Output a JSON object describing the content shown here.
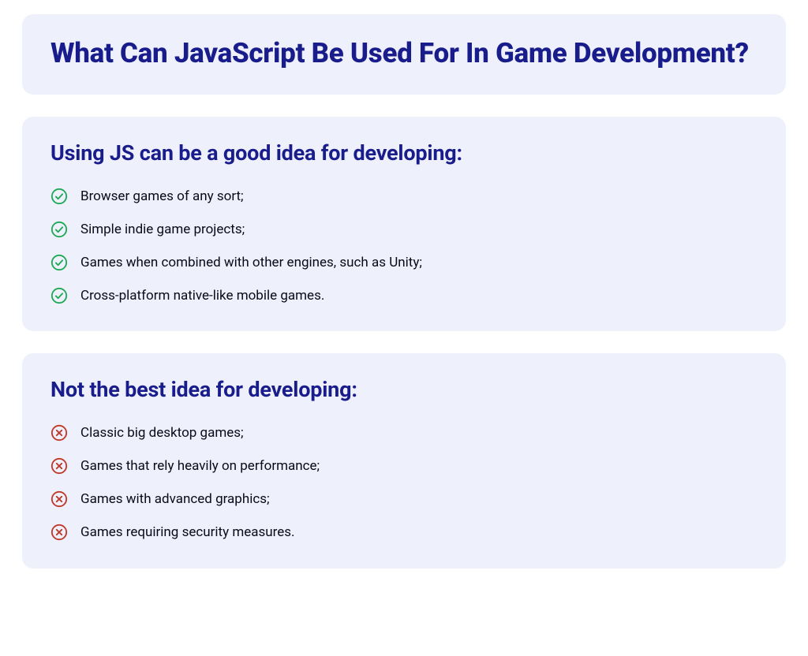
{
  "header": {
    "title": "What Can JavaScript Be Used For In Game Development?"
  },
  "sections": [
    {
      "heading": "Using JS can be a good idea for developing:",
      "icon": "check",
      "items": [
        "Browser games of any sort;",
        "Simple indie game projects;",
        "Games when combined with other engines, such as Unity;",
        "Cross-platform native-like mobile games."
      ]
    },
    {
      "heading": "Not the best idea for developing:",
      "icon": "cross",
      "items": [
        "Classic big desktop games;",
        "Games that rely heavily on performance;",
        "Games with advanced graphics;",
        "Games requiring security measures."
      ]
    }
  ],
  "colors": {
    "brand": "#191d8c",
    "card_bg": "#eef0fb",
    "check": "#1ea955",
    "cross": "#c0392b"
  }
}
